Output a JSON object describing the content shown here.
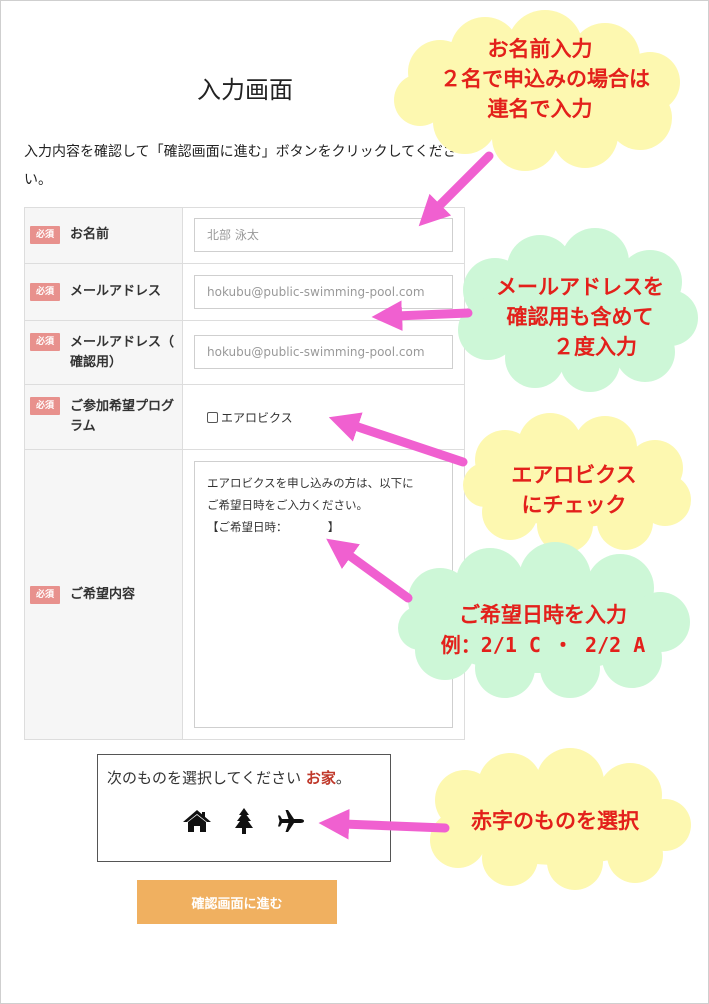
{
  "page": {
    "title": "入力画面",
    "intro": "入力内容を確認して「確認画面に進む」ボタンをクリックしてください。"
  },
  "form": {
    "required_badge": "必須",
    "fields": {
      "name": {
        "label": "お名前",
        "placeholder": "北部 泳太"
      },
      "email": {
        "label": "メールアドレス",
        "placeholder": "hokubu@public-swimming-pool.com"
      },
      "email_confirm": {
        "label_line1": "メールアドレス（",
        "label_line2": "確認用）",
        "placeholder": "hokubu@public-swimming-pool.com"
      },
      "program": {
        "label_line1": "ご参加希望プログ",
        "label_line2": "ラム",
        "option": "エアロビクス",
        "checked": false
      },
      "request": {
        "label": "ご希望内容",
        "line1": "エアロビクスを申し込みの方は、以下に",
        "line2": "ご希望日時をご入力ください。",
        "line3": "【ご希望日時：　　　　】"
      }
    }
  },
  "captcha": {
    "prompt": "次のものを選択してください",
    "key": "お家",
    "suffix": "。",
    "icons": [
      "house-icon",
      "tree-icon",
      "airplane-icon"
    ]
  },
  "submit": {
    "label": "確認画面に進む"
  },
  "annotations": {
    "name": {
      "line1": "お名前入力",
      "line2": "２名で申込みの場合は",
      "line3": "連名で入力"
    },
    "email": {
      "line1": "メールアドレスを",
      "line2": "確認用も含めて",
      "line3": "２度入力"
    },
    "aerobics": {
      "line1": "エアロビクス",
      "line2": "にチェック"
    },
    "datetime": {
      "line1": "ご希望日時を入力",
      "line2": "例：2/1 C ・ 2/2 A"
    },
    "captcha": {
      "line1": "赤字のものを選択"
    }
  },
  "colors": {
    "yellow_cloud": "#fdf8b0",
    "green_cloud": "#cdf7d7",
    "annotation_text": "#e3201b",
    "arrow": "#f060d0",
    "required_badge": "#e8918d",
    "submit_button": "#f0b060"
  }
}
